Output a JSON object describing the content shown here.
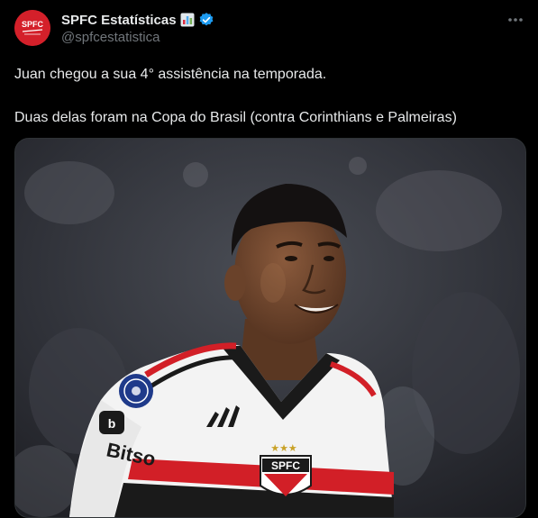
{
  "account": {
    "display_name": "SPFC Estatísticas",
    "handle": "@spfcestatistica",
    "avatar_text": "SPFC",
    "colors": {
      "verified": "#1d9bf0",
      "avatar_bg": "#d4202a"
    }
  },
  "tweet": {
    "line1": "Juan chegou a sua 4° assistência na temporada.",
    "line2": "Duas delas foram na Copa do Brasil (contra Corinthians e Palmeiras)"
  },
  "media": {
    "sponsor": "Bitso",
    "crest_text": "SPFC"
  },
  "icons": {
    "emoji": "bar-chart-emoji-icon",
    "verified": "verified-badge-icon",
    "more": "more-options-icon"
  }
}
